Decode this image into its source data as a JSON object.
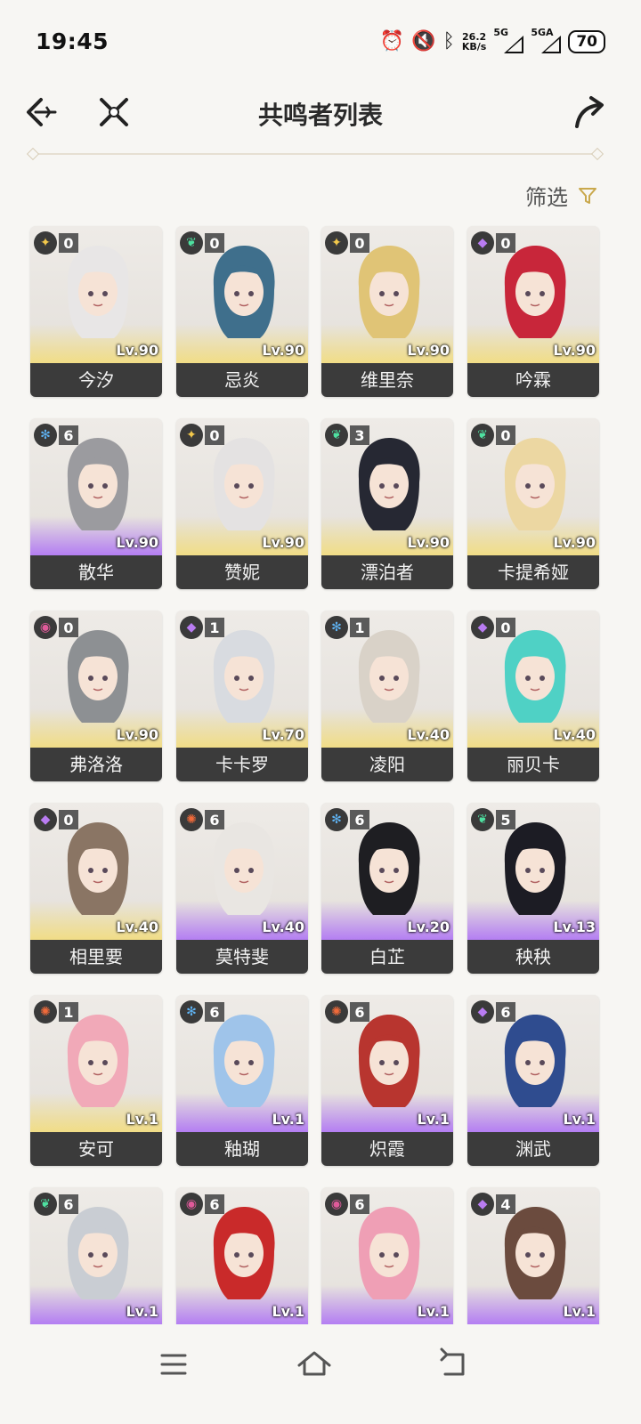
{
  "status": {
    "time": "19:45",
    "netspeed_value": "26.2",
    "netspeed_unit": "KB/s",
    "sig1_label": "5G",
    "sig2_label": "5GA",
    "battery": "70"
  },
  "header": {
    "title": "共鸣者列表"
  },
  "filter": {
    "label": "筛选"
  },
  "colors": {
    "accent": "#c9a84c",
    "name_bar": "#3b3b3b",
    "rarity5_glow": "#f1dd86",
    "rarity4_glow": "#b47ef2"
  },
  "resonators": [
    {
      "name": "今汐",
      "level": "Lv.90",
      "sequence": "0",
      "element": "spectro",
      "rarity": 5,
      "hair": "#e8e6e6"
    },
    {
      "name": "忌炎",
      "level": "Lv.90",
      "sequence": "0",
      "element": "aero",
      "rarity": 5,
      "hair": "#3f6f8c"
    },
    {
      "name": "维里奈",
      "level": "Lv.90",
      "sequence": "0",
      "element": "spectro",
      "rarity": 5,
      "hair": "#e0c476"
    },
    {
      "name": "吟霖",
      "level": "Lv.90",
      "sequence": "0",
      "element": "electro",
      "rarity": 5,
      "hair": "#c8263a"
    },
    {
      "name": "散华",
      "level": "Lv.90",
      "sequence": "6",
      "element": "glacio",
      "rarity": 4,
      "hair": "#9b9b9f"
    },
    {
      "name": "赞妮",
      "level": "Lv.90",
      "sequence": "0",
      "element": "spectro",
      "rarity": 5,
      "hair": "#e4e2e2"
    },
    {
      "name": "漂泊者",
      "level": "Lv.90",
      "sequence": "3",
      "element": "aero",
      "rarity": 5,
      "hair": "#262833"
    },
    {
      "name": "卡提希娅",
      "level": "Lv.90",
      "sequence": "0",
      "element": "aero",
      "rarity": 5,
      "hair": "#ecd7a2"
    },
    {
      "name": "弗洛洛",
      "level": "Lv.90",
      "sequence": "0",
      "element": "havoc",
      "rarity": 5,
      "hair": "#8d9093"
    },
    {
      "name": "卡卡罗",
      "level": "Lv.70",
      "sequence": "1",
      "element": "electro",
      "rarity": 5,
      "hair": "#d8dbe0"
    },
    {
      "name": "凌阳",
      "level": "Lv.40",
      "sequence": "1",
      "element": "glacio",
      "rarity": 5,
      "hair": "#d9d2c8"
    },
    {
      "name": "丽贝卡",
      "level": "Lv.40",
      "sequence": "0",
      "element": "electro",
      "rarity": 5,
      "hair": "#4fd1c5"
    },
    {
      "name": "相里要",
      "level": "Lv.40",
      "sequence": "0",
      "element": "electro",
      "rarity": 5,
      "hair": "#8a7564"
    },
    {
      "name": "莫特斐",
      "level": "Lv.40",
      "sequence": "6",
      "element": "fusion",
      "rarity": 4,
      "hair": "#e9e6e2"
    },
    {
      "name": "白芷",
      "level": "Lv.20",
      "sequence": "6",
      "element": "glacio",
      "rarity": 4,
      "hair": "#1e1e22"
    },
    {
      "name": "秧秧",
      "level": "Lv.13",
      "sequence": "5",
      "element": "aero",
      "rarity": 4,
      "hair": "#1c1c24"
    },
    {
      "name": "安可",
      "level": "Lv.1",
      "sequence": "1",
      "element": "fusion",
      "rarity": 5,
      "hair": "#f1a9b8"
    },
    {
      "name": "釉瑚",
      "level": "Lv.1",
      "sequence": "6",
      "element": "glacio",
      "rarity": 4,
      "hair": "#9fc4ea"
    },
    {
      "name": "炽霞",
      "level": "Lv.1",
      "sequence": "6",
      "element": "fusion",
      "rarity": 4,
      "hair": "#b8352f"
    },
    {
      "name": "渊武",
      "level": "Lv.1",
      "sequence": "6",
      "element": "electro",
      "rarity": 4,
      "hair": "#2f4c8f"
    },
    {
      "name": "",
      "level": "Lv.1",
      "sequence": "6",
      "element": "aero",
      "rarity": 4,
      "hair": "#c9cdd3"
    },
    {
      "name": "",
      "level": "Lv.1",
      "sequence": "6",
      "element": "havoc",
      "rarity": 4,
      "hair": "#c92a2a"
    },
    {
      "name": "",
      "level": "Lv.1",
      "sequence": "6",
      "element": "havoc",
      "rarity": 4,
      "hair": "#ef9fb5"
    },
    {
      "name": "",
      "level": "Lv.1",
      "sequence": "4",
      "element": "electro",
      "rarity": 4,
      "hair": "#6b4b3e"
    }
  ],
  "element_icons": {
    "spectro": {
      "glyph": "✦",
      "color": "#f2c84b"
    },
    "aero": {
      "glyph": "❦",
      "color": "#4ee0a0"
    },
    "electro": {
      "glyph": "◆",
      "color": "#b97cf2"
    },
    "glacio": {
      "glyph": "✻",
      "color": "#5fb4f5"
    },
    "havoc": {
      "glyph": "◉",
      "color": "#e05a9a"
    },
    "fusion": {
      "glyph": "✺",
      "color": "#f06a3a"
    }
  },
  "navbar": {
    "menu_icon": "menu-icon",
    "home_icon": "home-icon",
    "back_icon": "back-icon"
  }
}
